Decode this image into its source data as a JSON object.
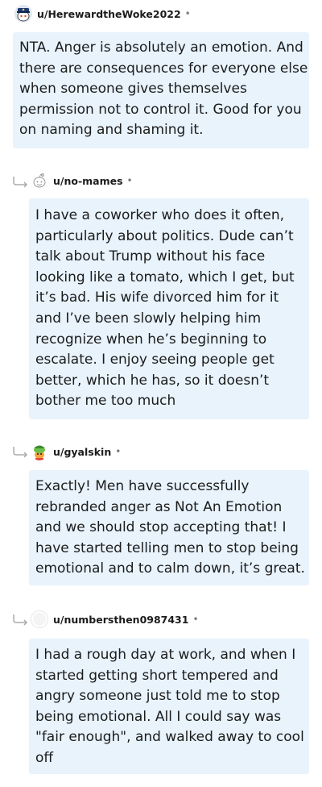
{
  "comments": [
    {
      "username": "u/HerewardtheWoke2022",
      "dot": "•",
      "avatar_icon": "police-snoo-avatar-icon",
      "body": "NTA. Anger is absolutely an emotion. And\nthere are consequences for everyone else\nwhen someone gives themselves\npermission not to control it. Good for you\non naming and shaming it."
    },
    {
      "username": "u/no-mames",
      "dot": "•",
      "avatar_icon": "default-snoo-avatar-icon",
      "body": "I have a coworker who does it often,\nparticularly about politics. Dude can’t\ntalk about Trump without his face\nlooking like a tomato, which I get, but\nit’s bad. His wife divorced him for it\nand I’ve been slowly helping him\nrecognize when he’s beginning to\nescalate. I enjoy seeing people get\nbetter, which he has, so it doesn’t\nbother me too much"
    },
    {
      "username": "u/gyalskin",
      "dot": "•",
      "avatar_icon": "colorful-snoo-avatar-icon",
      "body": "Exactly! Men have successfully\nrebranded anger as Not An Emotion\nand we should stop accepting that! I\nhave started telling men to stop being\nemotional and to calm down, it’s great."
    },
    {
      "username": "u/numbersthen0987431",
      "dot": "•",
      "avatar_icon": "blank-avatar-icon",
      "body": "I had a rough day at work, and when I\nstarted getting short tempered and\nangry someone just told me to stop\nbeing emotional. All I could say was\n\"fair enough\", and walked away to cool\noff"
    }
  ],
  "colors": {
    "bubble": "#e8f3fc",
    "text": "#1c1c1c",
    "muted": "#7c7c7c"
  }
}
